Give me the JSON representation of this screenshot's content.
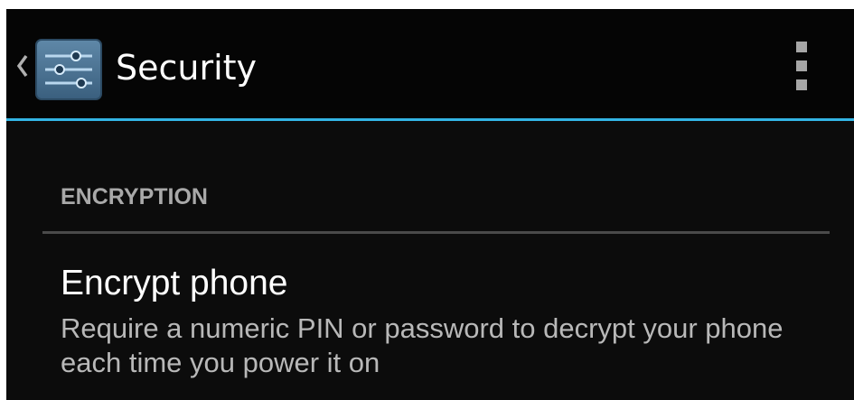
{
  "action_bar": {
    "title": "Security",
    "app_icon": "settings-sliders-icon",
    "up_icon": "chevron-left-icon",
    "overflow_icon": "overflow-menu-icon",
    "accent_color": "#33b5e5"
  },
  "section": {
    "header": "ENCRYPTION",
    "items": [
      {
        "title": "Encrypt phone",
        "summary": "Require a numeric PIN or password to decrypt your phone each time you power it on"
      }
    ]
  }
}
